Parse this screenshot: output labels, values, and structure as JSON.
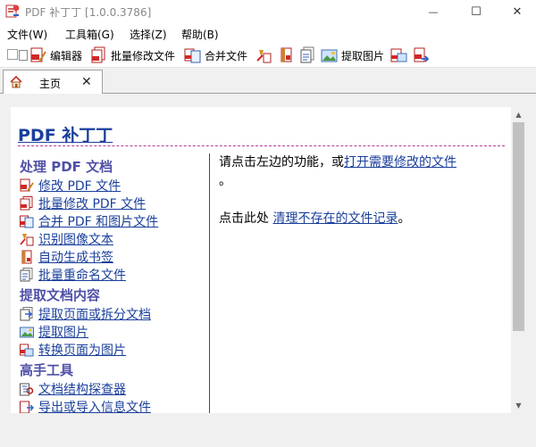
{
  "window": {
    "title": "PDF 补丁丁 [1.0.0.3786]",
    "minimize_glyph": "—",
    "maximize_glyph": "☐",
    "close_glyph": "✕"
  },
  "menu": [
    {
      "label": "文件(W)"
    },
    {
      "label": "工具箱(G)"
    },
    {
      "label": "选择(Z)"
    },
    {
      "label": "帮助(B)"
    }
  ],
  "toolbar": {
    "editor": "编辑器",
    "batch_modify": "批量修改文件",
    "merge": "合并文件",
    "extract_images": "提取图片"
  },
  "tab": {
    "label": "主页",
    "close_glyph": "✕"
  },
  "home": {
    "title": "PDF 补丁丁",
    "sections": [
      {
        "heading": "处理 PDF 文档",
        "links": [
          "修改 PDF 文件",
          "批量修改 PDF 文件",
          "合并 PDF 和图片文件",
          "识别图像文本",
          "自动生成书签",
          "批量重命名文件"
        ]
      },
      {
        "heading": "提取文档内容",
        "links": [
          "提取页面或拆分文档",
          "提取图片",
          "转换页面为图片"
        ]
      },
      {
        "heading": "高手工具",
        "links": [
          "文档结构探查器",
          "导出或导入信息文件"
        ]
      }
    ],
    "hint": {
      "line1_prefix": "请点击左边的功能，或",
      "line1_link": "打开需要修改的文件",
      "line1_suffix": "。",
      "line2_prefix": "点击此处 ",
      "line2_link": "清理不存在的文件记录",
      "line2_suffix": "。"
    }
  },
  "colors": {
    "link": "#1a3f9b",
    "section_heading": "#5050a8",
    "title_rule": "#b03c9a",
    "column_divider": "#3a3ab0"
  },
  "icons": {
    "app": "pdf-patcher-logo-icon",
    "toolbar": [
      "checkbox-icon",
      "pdf-edit-icon",
      "pdf-batch-icon",
      "merge-files-icon",
      "ocr-icon",
      "bookmark-icon",
      "rename-icon",
      "extract-images-icon",
      "pdf-image-icon",
      "pdf-export-icon"
    ]
  }
}
